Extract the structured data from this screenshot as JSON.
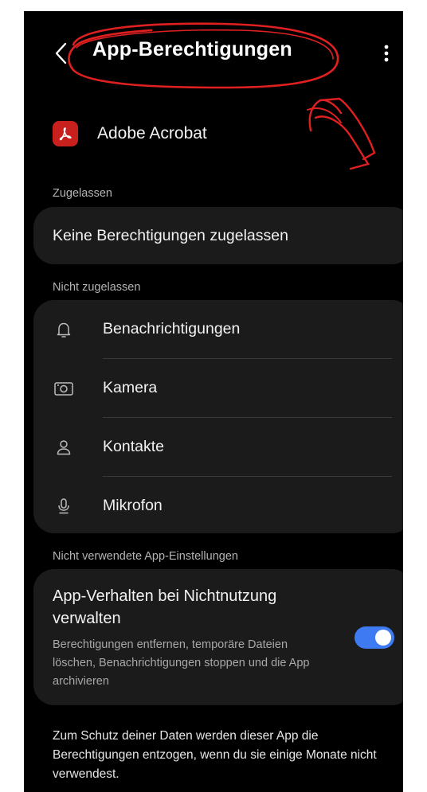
{
  "header": {
    "title": "App-Berechtigungen",
    "back_icon": "chevron-left-icon",
    "more_icon": "more-vertical-icon"
  },
  "app": {
    "name": "Adobe Acrobat",
    "icon": "adobe-acrobat-logo",
    "icon_color": "#c8201d"
  },
  "allowed": {
    "label": "Zugelassen",
    "empty_text": "Keine Berechtigungen zugelassen"
  },
  "denied": {
    "label": "Nicht zugelassen",
    "items": [
      {
        "label": "Benachrichtigungen",
        "icon": "bell-icon"
      },
      {
        "label": "Kamera",
        "icon": "camera-icon"
      },
      {
        "label": "Kontakte",
        "icon": "person-icon"
      },
      {
        "label": "Mikrofon",
        "icon": "microphone-icon"
      }
    ]
  },
  "unused": {
    "label": "Nicht verwendete App-Einstellungen",
    "title": "App-Verhalten bei Nichtnutzung verwalten",
    "description": "Berechtigungen entfernen, temporäre Dateien löschen, Benachrichtigungen stoppen und die App archivieren",
    "toggle_on": true,
    "toggle_color": "#3e7bf2"
  },
  "footer": {
    "note": "Zum Schutz deiner Daten werden dieser App die Berechtigungen entzogen, wenn du sie einige Monate nicht verwendest."
  },
  "colors": {
    "background": "#000000",
    "card": "#1b1b1b",
    "annotation": "#e02020"
  }
}
